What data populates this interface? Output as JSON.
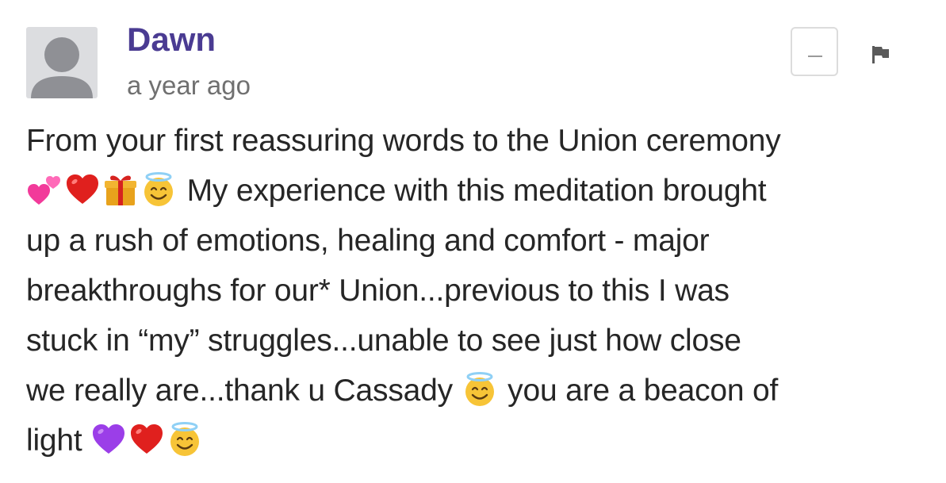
{
  "author": {
    "name": "Dawn",
    "avatar_icon": "default-avatar-icon"
  },
  "timestamp": "a year ago",
  "actions": {
    "collapse_icon": "minus-icon",
    "flag_icon": "flag-icon"
  },
  "comment": {
    "lines": [
      {
        "segments": [
          {
            "text": "From your first reassuring words to the Union ceremony"
          }
        ]
      },
      {
        "segments": [
          {
            "emoji": "two-hearts-icon"
          },
          {
            "emoji": "red-heart-icon"
          },
          {
            "emoji": "gift-icon"
          },
          {
            "emoji": "smiling-face-with-halo-icon"
          },
          {
            "text": " My experience with this meditation brought"
          }
        ]
      },
      {
        "segments": [
          {
            "text": "up a rush of emotions, healing and comfort - major"
          }
        ]
      },
      {
        "segments": [
          {
            "text": "breakthroughs for our* Union...previous to this I was"
          }
        ]
      },
      {
        "segments": [
          {
            "text": "stuck in “my” struggles...unable to see just how close"
          }
        ]
      },
      {
        "segments": [
          {
            "text": "we really are...thank u Cassady "
          },
          {
            "emoji": "smiling-face-with-halo-icon"
          },
          {
            "text": " you are a beacon of"
          }
        ]
      },
      {
        "segments": [
          {
            "text": "light "
          },
          {
            "emoji": "purple-heart-icon"
          },
          {
            "emoji": "red-heart-icon"
          },
          {
            "emoji": "smiling-face-with-halo-icon"
          }
        ]
      }
    ]
  }
}
